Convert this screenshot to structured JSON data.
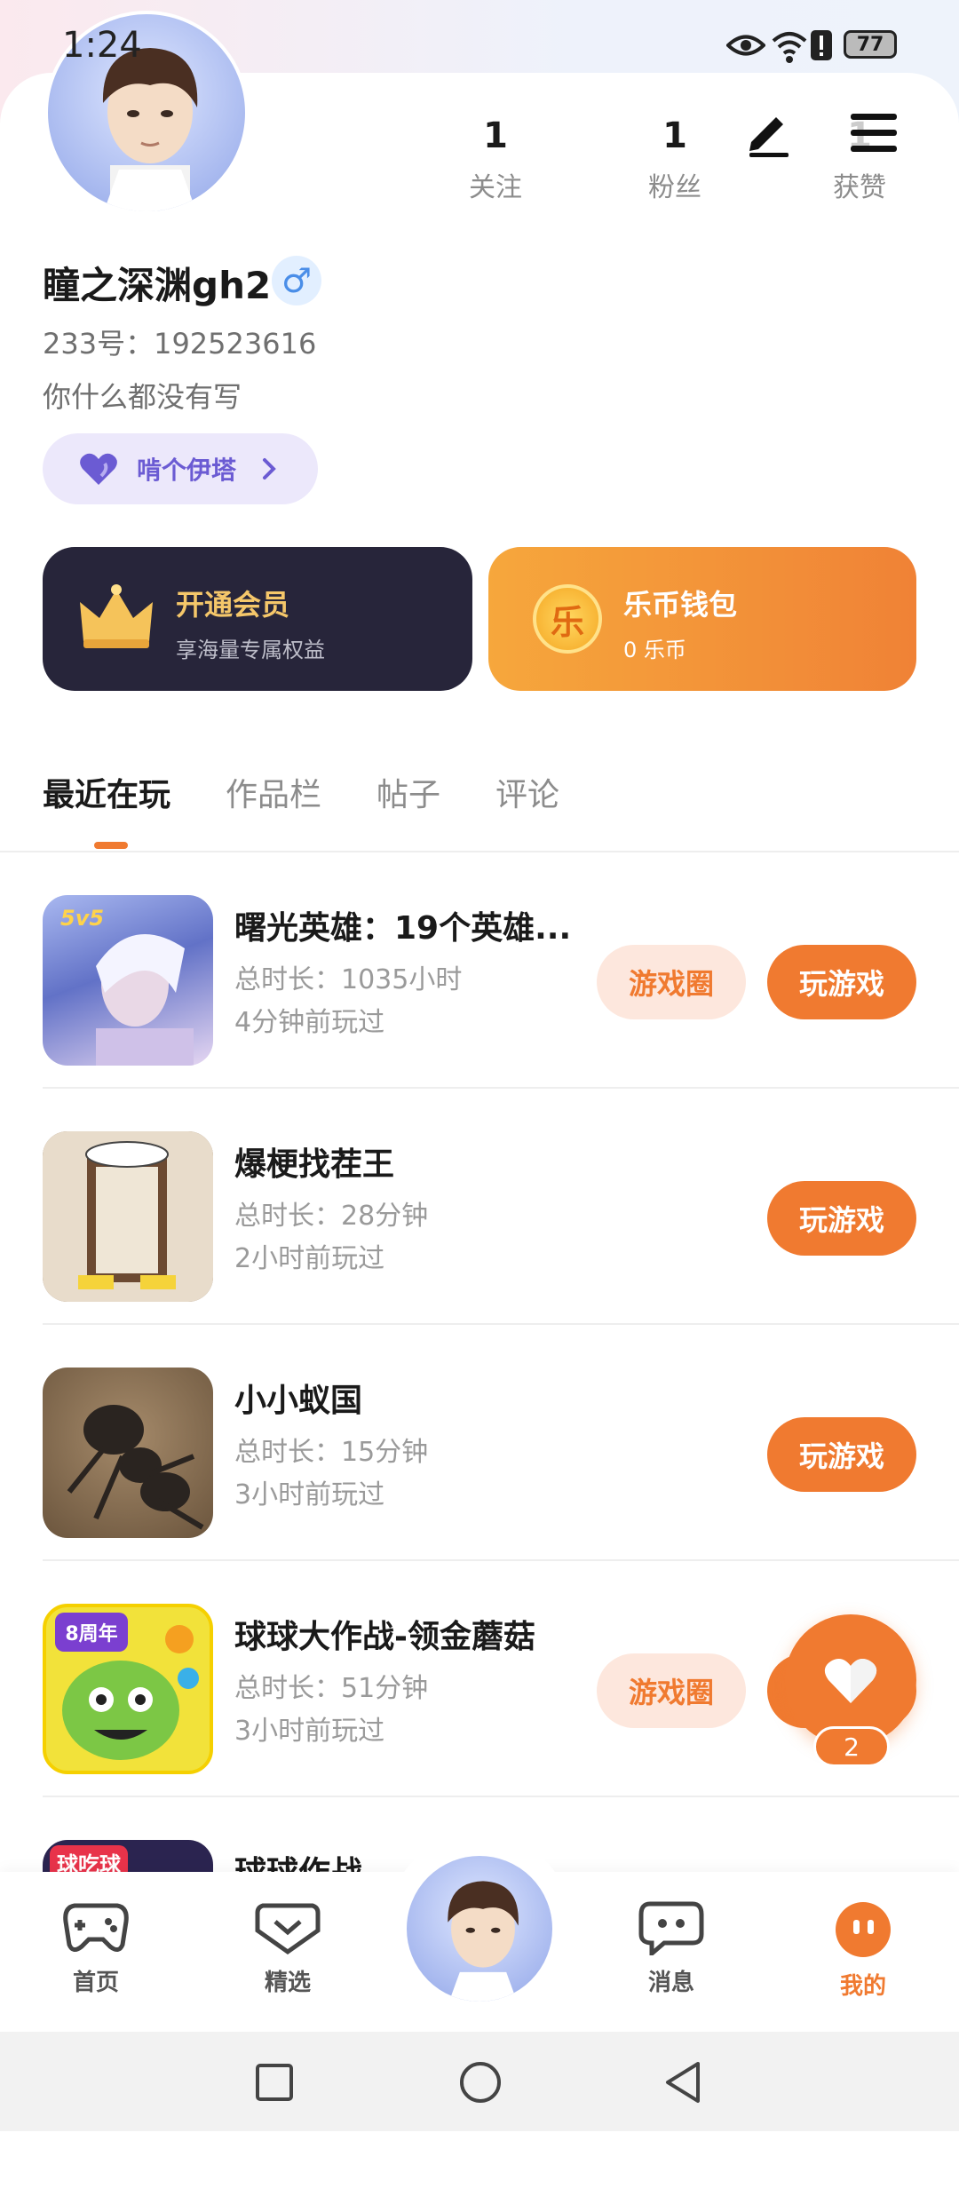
{
  "status_bar": {
    "time": "1:24",
    "battery": "77"
  },
  "profile": {
    "stats": [
      {
        "num": "1",
        "label": "关注"
      },
      {
        "num": "1",
        "label": "粉丝"
      },
      {
        "num": "1",
        "label": "获赞"
      }
    ],
    "name": "瞳之深渊gh2",
    "gender_symbol": "♂",
    "uid": "233号：192523616",
    "bio": "你什么都没有写",
    "pill_label": "啃个伊塔"
  },
  "cards": {
    "vip": {
      "title": "开通会员",
      "subtitle": "享海量专属权益"
    },
    "wallet": {
      "icon_text": "乐",
      "title": "乐币钱包",
      "subtitle": "0 乐币"
    }
  },
  "tabs": [
    "最近在玩",
    "作品栏",
    "帖子",
    "评论"
  ],
  "games": [
    {
      "title": "曙光英雄：19个英雄...",
      "duration": "总时长：1035小时",
      "last_played": "4分钟前玩过",
      "circle_label": "游戏圈",
      "play_label": "玩游戏",
      "badge": "5v5"
    },
    {
      "title": "爆梗找茬王",
      "duration": "总时长：28分钟",
      "last_played": "2小时前玩过",
      "play_label": "玩游戏"
    },
    {
      "title": "小小蚁国",
      "duration": "总时长：15分钟",
      "last_played": "3小时前玩过",
      "play_label": "玩游戏"
    },
    {
      "title": "球球大作战-领金蘑菇",
      "duration": "总时长：51分钟",
      "last_played": "3小时前玩过",
      "circle_label": "游戏圈",
      "badge": "8周年"
    },
    {
      "title": "球球作战",
      "badge": "球吃球"
    }
  ],
  "float_like": {
    "count": "2"
  },
  "bottom_nav": [
    {
      "label": "首页",
      "icon": "gamepad-icon"
    },
    {
      "label": "精选",
      "icon": "heart-chat-icon"
    },
    {
      "label": "消息",
      "icon": "message-icon"
    },
    {
      "label": "我的",
      "icon": "profile-face-icon"
    }
  ],
  "colors": {
    "accent": "#f07a30",
    "vip_bg": "#27253a",
    "vip_text": "#f5c76a",
    "pill": "#6b5bd3"
  }
}
